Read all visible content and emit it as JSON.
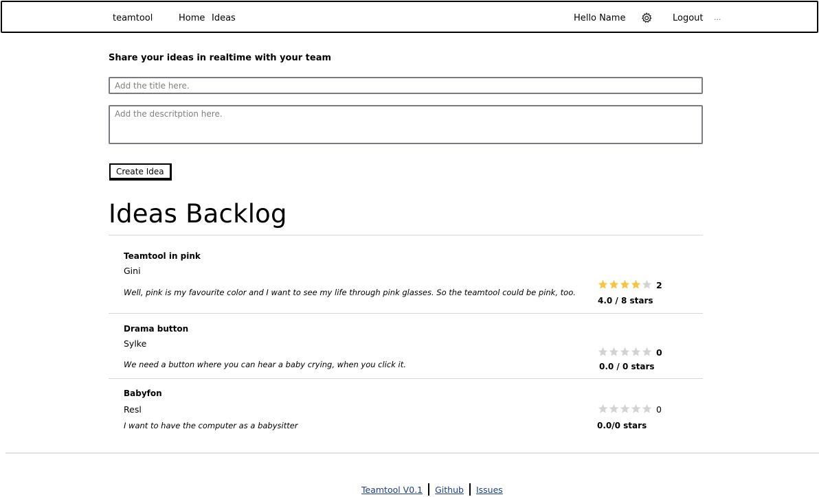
{
  "nav": {
    "brand": "teamtool",
    "links": [
      "Home",
      "Ideas"
    ],
    "greeting": "Hello Name",
    "settings_icon": "gear-icon",
    "logout": "Logout",
    "more": "..."
  },
  "form": {
    "heading": "Share your ideas in realtime with your team",
    "title_placeholder": "Add the title here.",
    "description_placeholder": "Add the descritption here.",
    "create_label": "Create Idea"
  },
  "backlog": {
    "title": "Ideas Backlog",
    "ideas": [
      {
        "title": "Teamtool in pink",
        "author": "Gini",
        "description": "Well, pink is my favourite color and I want to see my life through pink glasses. So the teamtool could be pink, too.",
        "stars_filled": 4,
        "stars_total": 5,
        "votes": "2",
        "rating": "4.0 / 8 stars"
      },
      {
        "title": "Drama button",
        "author": "Sylke",
        "description": "We need a button where you can hear a baby crying, when you click it.",
        "stars_filled": 0,
        "stars_total": 5,
        "votes": "0",
        "rating": "0.0 / 0 stars"
      },
      {
        "title": "Babyfon",
        "author": "Resl",
        "description": "I want to have the computer as a babysitter",
        "stars_filled": 0,
        "stars_total": 5,
        "votes": "0",
        "rating": "0.0/0 stars"
      }
    ]
  },
  "footer": {
    "links": [
      "Teamtool V0.1",
      "Github",
      "Issues"
    ]
  },
  "colors": {
    "star_filled": "#f5c542",
    "star_empty": "#d3d3d3",
    "link": "#1a3f8f",
    "input_border": "#7a7a80"
  }
}
